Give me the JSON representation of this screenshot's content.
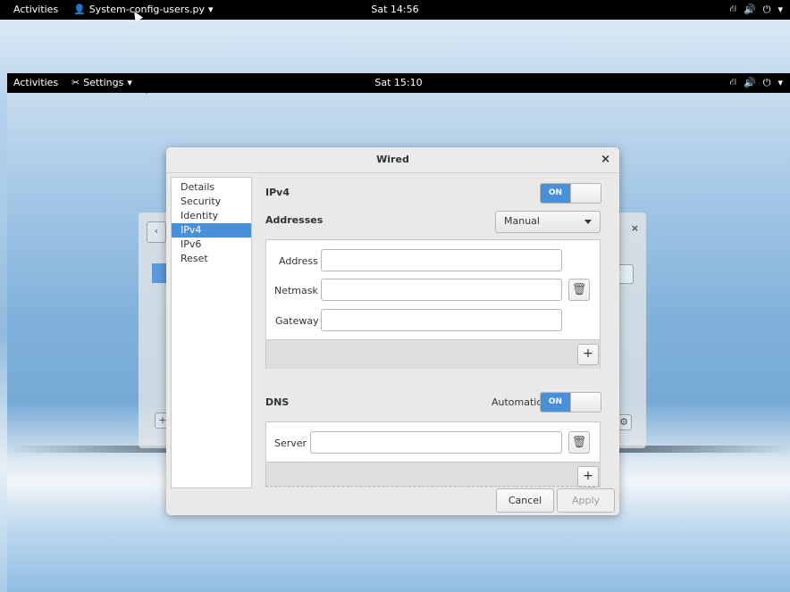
{
  "topbar1": {
    "activities": "Activities",
    "app": "System-config-users.py",
    "clock": "Sat 14:56"
  },
  "topbar2": {
    "activities": "Activities",
    "app": "Settings",
    "clock": "Sat 15:10"
  },
  "tray": {
    "network_icon": "network-icon",
    "volume_icon": "volume-icon",
    "power_icon": "power-icon",
    "dropdown": "▾"
  },
  "dialog": {
    "title": "Wired",
    "close": "×",
    "sidebar": [
      "Details",
      "Security",
      "Identity",
      "IPv4",
      "IPv6",
      "Reset"
    ],
    "selected": "IPv4",
    "ipv4_label": "IPv4",
    "ipv4_switch": "ON",
    "addresses_label": "Addresses",
    "method": "Manual",
    "address_label": "Address",
    "netmask_label": "Netmask",
    "gateway_label": "Gateway",
    "address_value": "",
    "netmask_value": "",
    "gateway_value": "",
    "add": "+",
    "dns_label": "DNS",
    "dns_automatic": "Automatic",
    "dns_switch": "ON",
    "server_label": "Server",
    "server_value": "",
    "cancel": "Cancel",
    "apply": "Apply"
  },
  "colors": {
    "accent": "#4a90d9",
    "topbar": "#000000"
  }
}
